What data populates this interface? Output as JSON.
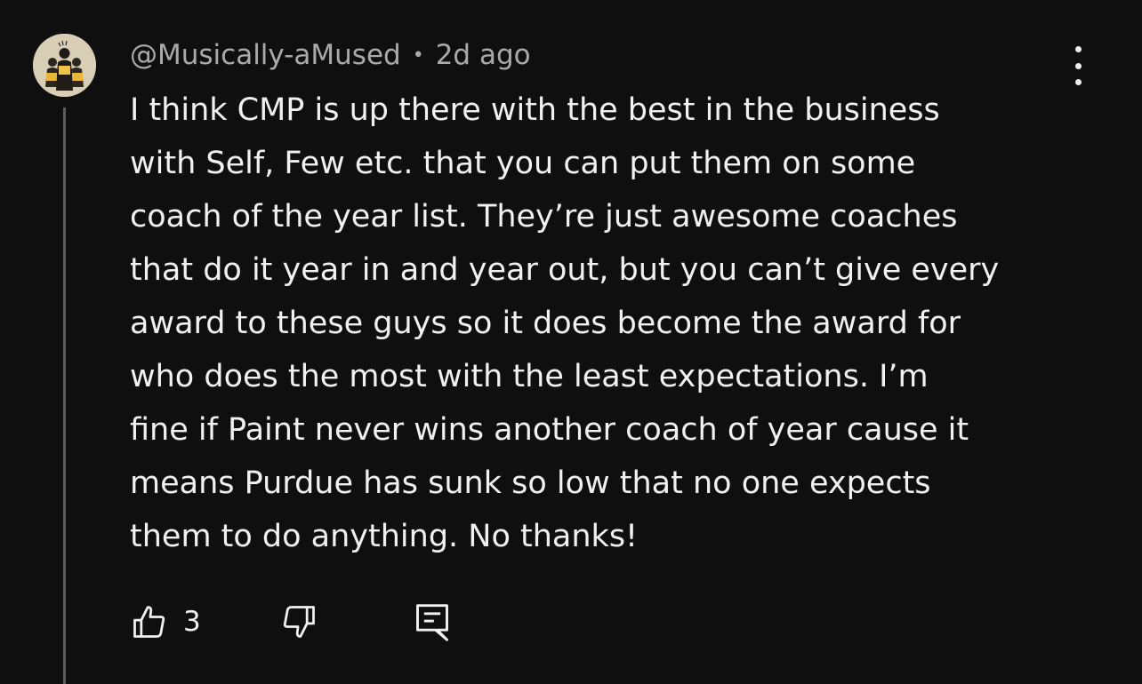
{
  "comment": {
    "author": "@Musically-aMused",
    "separator": "•",
    "timestamp": "2d ago",
    "body_lines": [
      "I think CMP is up there with the best in the business",
      "with Self, Few  etc. that you can put them on some",
      "coach of the year list. They’re just awesome coaches",
      "that do it year in and year out, but you can’t give every",
      "award to these guys so it does become the award for",
      "who does the most with the least expectations. I’m",
      "fine if Paint never wins another coach of year cause it",
      "means Purdue has sunk so low that no one expects",
      "them to do anything. No thanks!"
    ],
    "like_count": "3"
  },
  "icons": {
    "avatar": "avatar-illustration",
    "more": "more-vertical-icon",
    "like": "thumbs-up-icon",
    "dislike": "thumbs-down-icon",
    "reply": "reply-comment-icon"
  },
  "colors": {
    "background": "#0f0f0f",
    "text_primary": "#f1f1f1",
    "text_secondary": "#aaaaaa",
    "thread_line": "#5c5c5c"
  }
}
